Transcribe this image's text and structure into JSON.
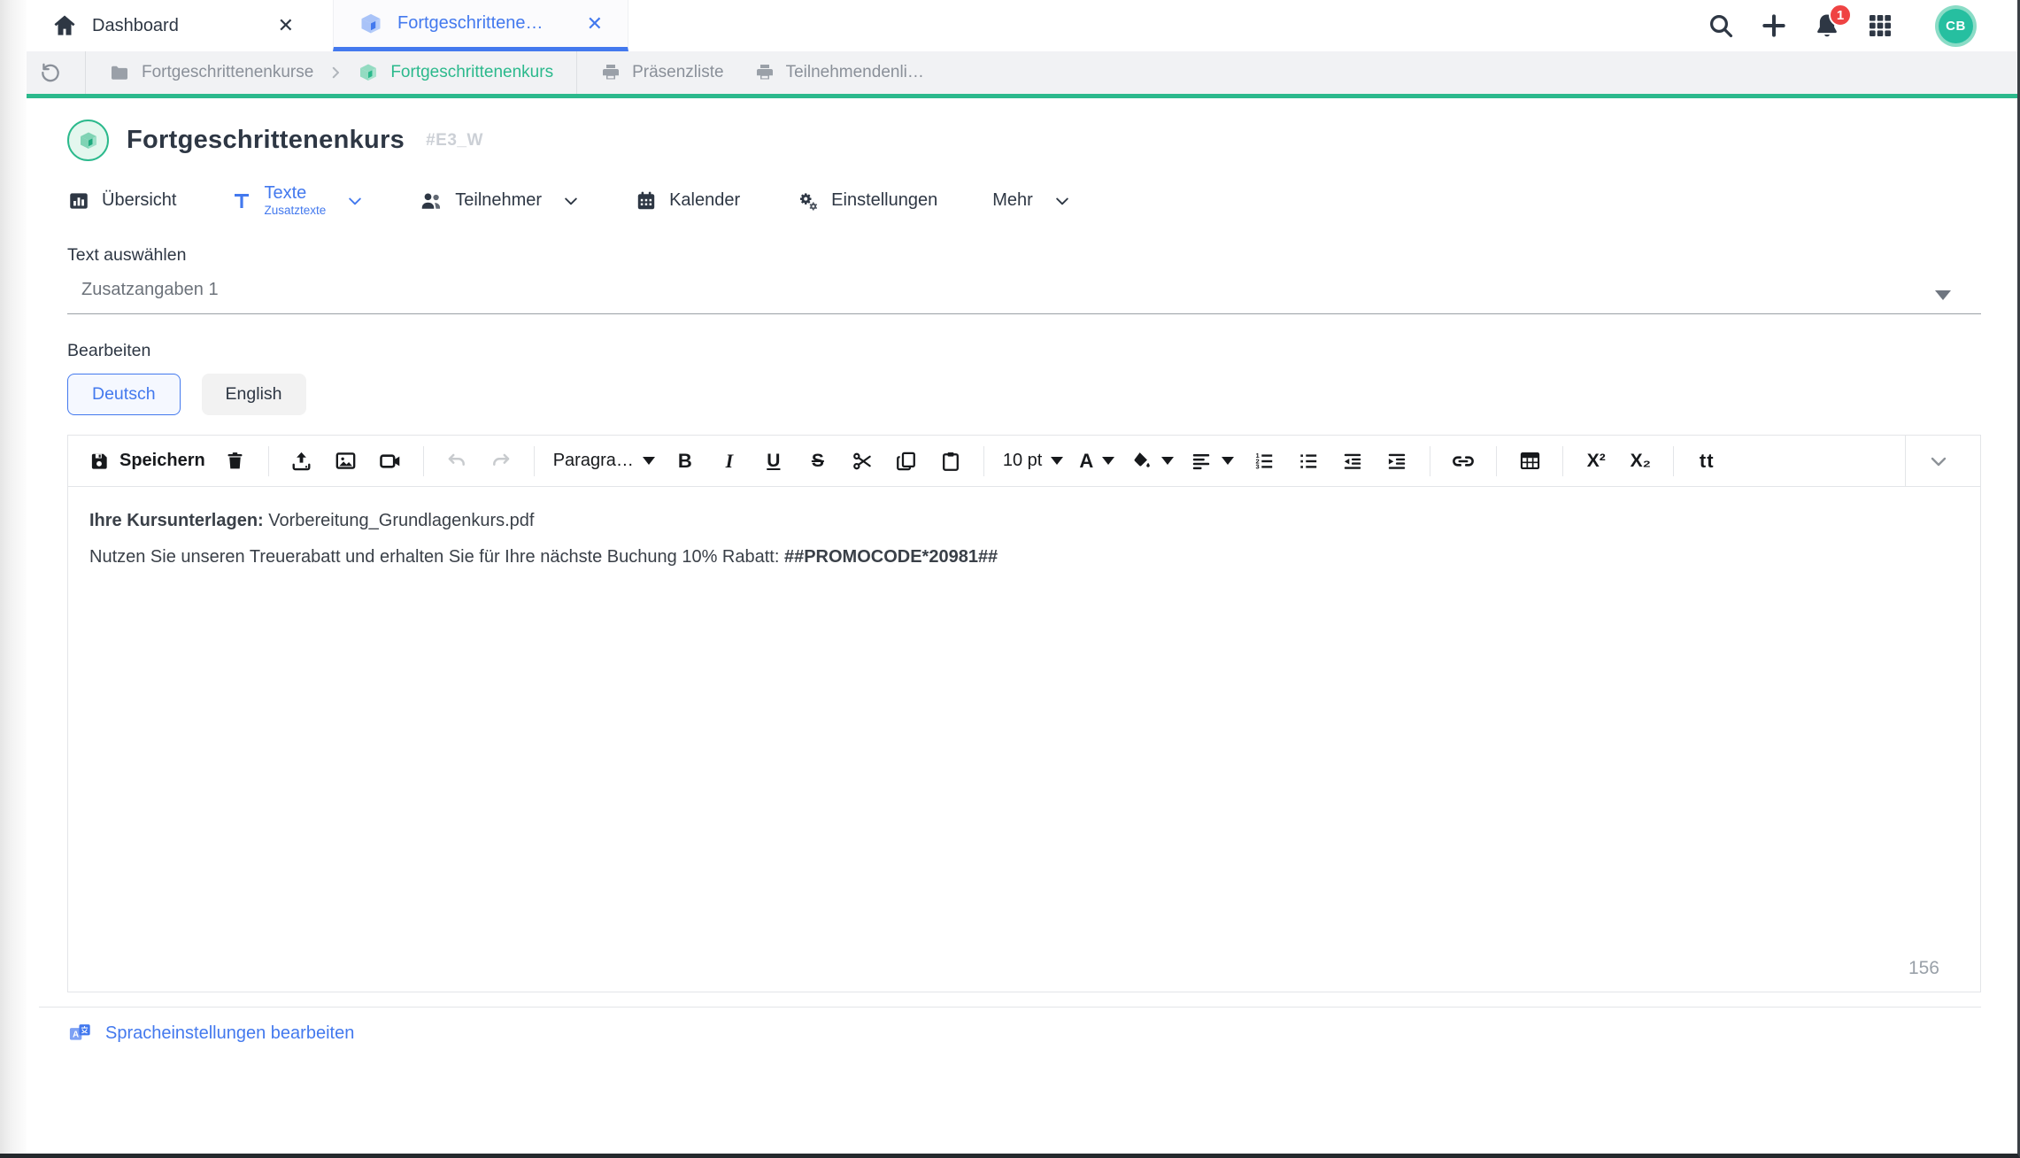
{
  "window": {
    "tabs": [
      {
        "label": "Dashboard",
        "icon": "home",
        "active": false
      },
      {
        "label": "Fortgeschrittene…",
        "icon": "cube",
        "active": true
      }
    ],
    "close_glyph": "✕",
    "notification_count": "1",
    "avatar_initials": "CB"
  },
  "breadcrumb": {
    "path": [
      {
        "label": "Fortgeschrittenenkurse",
        "icon": "folder"
      },
      {
        "label": "Fortgeschrittenenkurs",
        "icon": "cube",
        "active": true
      }
    ],
    "quick_links": [
      {
        "label": "Präsenzliste",
        "icon": "printer"
      },
      {
        "label": "Teilnehmendenli…",
        "icon": "printer"
      }
    ]
  },
  "page": {
    "title": "Fortgeschrittenenkurs",
    "badge": "#E3_W"
  },
  "nav": {
    "items": [
      {
        "label": "Übersicht"
      },
      {
        "label": "Texte",
        "sublabel": "Zusatztexte",
        "active": true
      },
      {
        "label": "Teilnehmer"
      },
      {
        "label": "Kalender"
      },
      {
        "label": "Einstellungen"
      },
      {
        "label": "Mehr"
      }
    ]
  },
  "form": {
    "select_label": "Text auswählen",
    "select_value": "Zusatzangaben 1",
    "edit_label": "Bearbeiten",
    "languages": [
      {
        "label": "Deutsch",
        "active": true
      },
      {
        "label": "English",
        "active": false
      }
    ]
  },
  "toolbar": {
    "save_label": "Speichern",
    "paragraph_label": "Paragra…",
    "font_size_label": "10 pt",
    "bold_label": "B",
    "italic_label": "I",
    "underline_label": "U",
    "strikethrough_label": "S",
    "font_color_label": "A",
    "superscript_label": "X²",
    "subscript_label": "X₂",
    "text_transform_label": "tt"
  },
  "editor": {
    "line1_bold": "Ihre Kursunterlagen:",
    "line1_regular": " Vorbereitung_Grundlagenkurs.pdf",
    "line2_regular": "Nutzen Sie unseren Treuerabatt und erhalten Sie für Ihre nächste Buchung 10% Rabatt: ",
    "line2_bold": "##PROMOCODE*20981##",
    "char_count": "156"
  },
  "footer": {
    "language_settings_label": "Spracheinstellungen bearbeiten"
  },
  "colors": {
    "accent_blue": "#4379EE",
    "accent_teal": "#2BB98C",
    "notification_red": "#EF4343",
    "avatar_teal": "#26BFA0"
  }
}
